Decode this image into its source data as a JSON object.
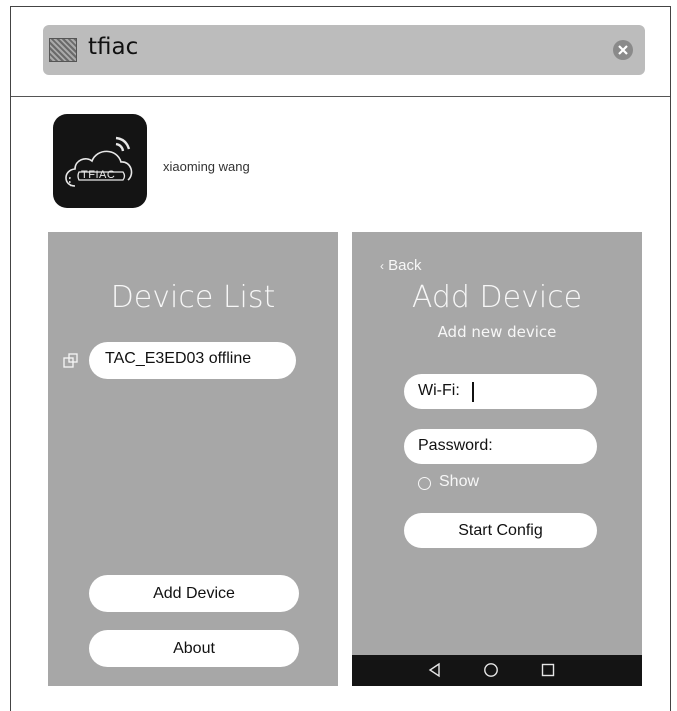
{
  "search": {
    "query": "tfiac",
    "app_icon": "app-thumbnail-icon",
    "clear_icon": "clear-icon"
  },
  "profile": {
    "logo_text": "TFIAC",
    "user_name": "xiaoming wang"
  },
  "device_list": {
    "title": "Device List",
    "devices": [
      {
        "label": "TAC_E3ED03 offline"
      }
    ],
    "add_device_label": "Add Device",
    "about_label": "About"
  },
  "add_device": {
    "back_label": "Back",
    "title": "Add Device",
    "subtitle": "Add new device",
    "wifi_label": "Wi-Fi:",
    "wifi_value": "",
    "password_label": "Password:",
    "show_label": "Show",
    "start_config_label": "Start Config"
  },
  "nav": {
    "back_icon": "back-triangle-icon",
    "home_icon": "home-circle-icon",
    "recents_icon": "recents-square-icon"
  },
  "colors": {
    "panel_gray": "#a7a7a7",
    "search_gray": "#bcbcbc",
    "nav_black": "#141414",
    "white": "#ffffff"
  }
}
